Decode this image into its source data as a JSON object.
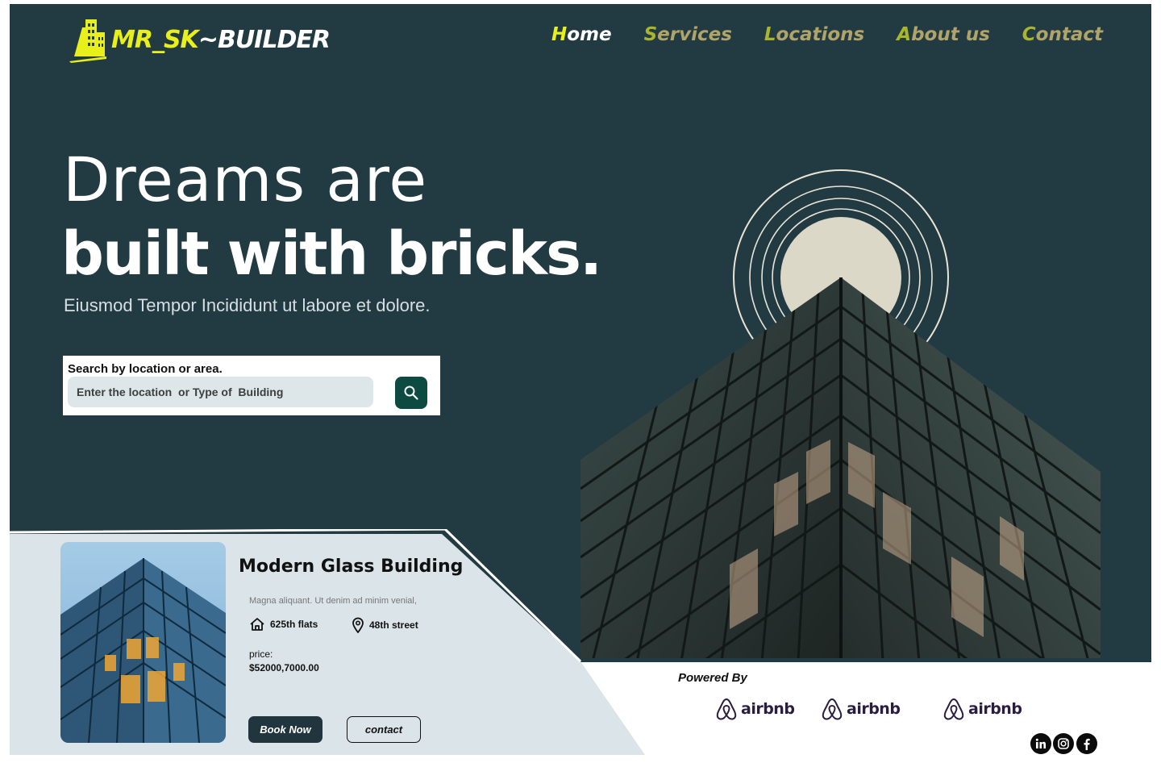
{
  "brand": {
    "name_part1": "MR_SK",
    "name_part2": "~BUILDER",
    "logo_icon": "building-icon",
    "accent_color": "#e8ef1a",
    "bg_color": "#223a42"
  },
  "nav": {
    "items": [
      {
        "first": "H",
        "rest": "ome",
        "active": true
      },
      {
        "first": "S",
        "rest": "ervices",
        "active": false
      },
      {
        "first": "L",
        "rest": "ocations",
        "active": false
      },
      {
        "first": "A",
        "rest": "bout us",
        "active": false
      },
      {
        "first": "C",
        "rest": "ontact",
        "active": false
      }
    ]
  },
  "hero": {
    "headline_line1": "Dreams are",
    "headline_line2": "built with bricks.",
    "subtitle": "Eiusmod Tempor Incididunt ut labore et dolore."
  },
  "search": {
    "label": "Search by location or area.",
    "placeholder": "Enter the location  or Type of  Building",
    "button_icon": "search-icon"
  },
  "card": {
    "title": "Modern Glass Building",
    "description": "Magna aliquant. Ut denim ad minim venial,",
    "flats_icon": "home-icon",
    "flats": "625th flats",
    "location_icon": "location-pin-icon",
    "street": "48th street",
    "price_label": "price:",
    "price_value": "$52000,7000.00",
    "book_label": "Book Now",
    "contact_label": "contact"
  },
  "partners": {
    "powered_by": "Powered By",
    "logos": [
      "airbnb",
      "airbnb",
      "airbnb"
    ],
    "logo_icon": "airbnb-icon"
  },
  "social": {
    "icons": [
      "linkedin-icon",
      "instagram-icon",
      "facebook-icon"
    ]
  }
}
